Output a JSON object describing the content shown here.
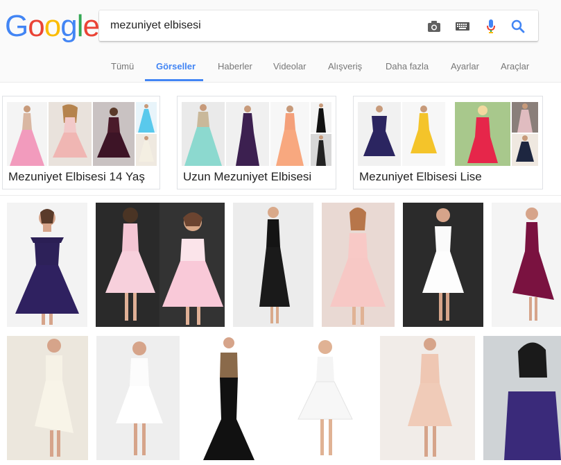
{
  "logo": {
    "letters": [
      "G",
      "o",
      "o",
      "g",
      "l",
      "e"
    ],
    "colors": [
      "#4285F4",
      "#EA4335",
      "#FBBC05",
      "#4285F4",
      "#34A853",
      "#EA4335"
    ]
  },
  "search": {
    "query": "mezuniyet elbisesi",
    "icons": [
      "camera-icon",
      "keyboard-icon",
      "microphone-icon",
      "search-icon"
    ]
  },
  "tabs": [
    {
      "label": "Tümü"
    },
    {
      "label": "Görseller",
      "active": true
    },
    {
      "label": "Haberler"
    },
    {
      "label": "Videolar"
    },
    {
      "label": "Alışveriş"
    },
    {
      "label": "Daha fazla"
    },
    {
      "label": "Ayarlar"
    },
    {
      "label": "Araçlar"
    }
  ],
  "related": [
    {
      "label": "Mezuniyet Elbisesi 14 Yaş"
    },
    {
      "label": "Uzun Mezuniyet Elbisesi"
    },
    {
      "label": "Mezuniyet Elbisesi Lise"
    }
  ],
  "colors": {
    "accent": "#4285f4",
    "tab_text": "#777777"
  }
}
